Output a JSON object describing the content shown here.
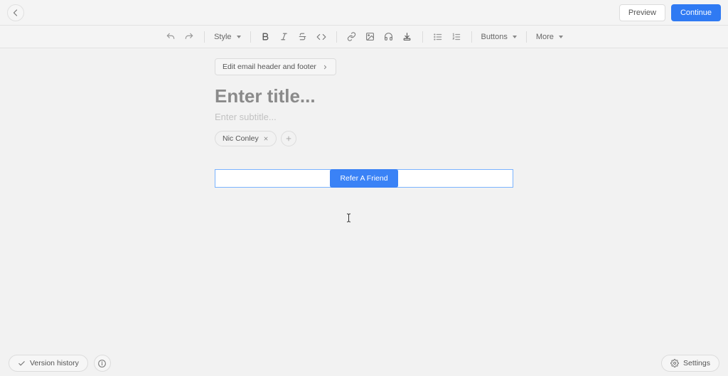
{
  "header": {
    "preview_label": "Preview",
    "continue_label": "Continue"
  },
  "toolbar": {
    "style_label": "Style",
    "buttons_label": "Buttons",
    "more_label": "More"
  },
  "editor": {
    "header_footer_label": "Edit email header and footer",
    "title_placeholder": "Enter title...",
    "subtitle_placeholder": "Enter subtitle...",
    "author_name": "Nic Conley",
    "refer_button_label": "Refer A Friend"
  },
  "footer": {
    "version_history_label": "Version history",
    "settings_label": "Settings"
  }
}
